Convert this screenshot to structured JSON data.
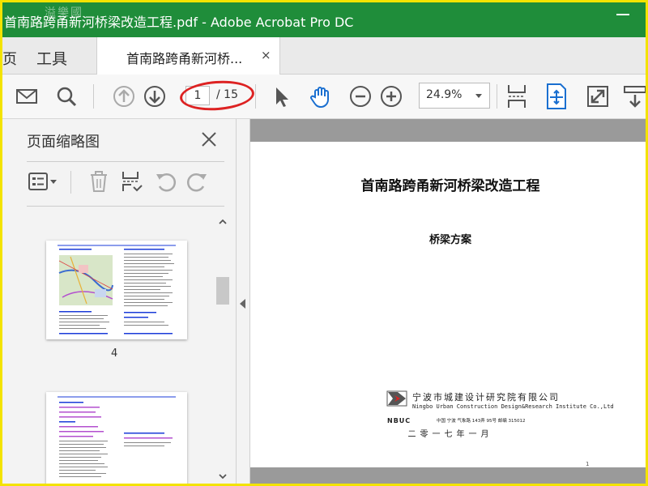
{
  "window": {
    "title": "首南路跨甬新河桥梁改造工程.pdf - Adobe Acrobat Pro DC",
    "watermark": "溢樂國",
    "accent_color": "#1f8d3a"
  },
  "tabs": {
    "home_label": "页",
    "tools_label": "工具",
    "doc_label": "首南路跨甬新河桥...",
    "doc_close": "×"
  },
  "toolbar": {
    "icons": [
      "email-icon",
      "search-icon",
      "prev-page-icon",
      "next-page-icon",
      "select-cursor-icon",
      "hand-tool-icon",
      "zoom-out-icon",
      "zoom-in-icon",
      "scroll-mode-icon",
      "fit-page-icon",
      "fullscreen-icon",
      "more-tools-icon"
    ],
    "current_page": "1",
    "total_pages": "/ 15",
    "zoom": "24.9%"
  },
  "left_panel": {
    "title": "页面缩略图",
    "thumbnail_page_label": "4"
  },
  "document": {
    "title": "首南路跨甬新河桥梁改造工程",
    "subtitle": "桥梁方案",
    "org_cn": "宁波市城建设计研究院有限公司",
    "org_en": "Ningbo Urban Construction Design&Research Institute Co.,Ltd",
    "org_abbr": "NBUC",
    "address": "中国 宁波    气象路 143弄 95号    邮编 315012",
    "date": "二零一七年一月",
    "page_footer": "1"
  }
}
